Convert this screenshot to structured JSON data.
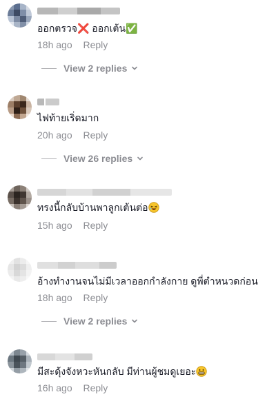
{
  "comments": [
    {
      "text": "ออกตรวจ❌ ออกเต้น✅",
      "time": "18h ago",
      "reply_label": "Reply",
      "view_replies": "View 2 replies"
    },
    {
      "text": "ไฟท้ายเริ่ดมาก",
      "time": "20h ago",
      "reply_label": "Reply",
      "view_replies": "View 26 replies"
    },
    {
      "text": "ทรงนี้กลับบ้านพาลูกเต้นต่อ",
      "emoji": "laughing-face",
      "time": "15h ago",
      "reply_label": "Reply"
    },
    {
      "text": "อ้างทำงานจนไม่มีเวลาออกกำลังกาย ดูพี่ตำหนวดก่อน",
      "time": "18h ago",
      "reply_label": "Reply",
      "view_replies": "View 2 replies"
    },
    {
      "text": "มีสะดุ้งจังหวะหันกลับ มีท่านผู้ชมดูเยอะ",
      "emoji": "grinning-face",
      "time": "16h ago",
      "reply_label": "Reply"
    }
  ],
  "colors": {
    "text": "#161823",
    "muted": "rgba(22,24,35,0.5)",
    "cross": "#d32f2f",
    "check": "#43a047",
    "emoji_yellow": "#f7c52b"
  }
}
